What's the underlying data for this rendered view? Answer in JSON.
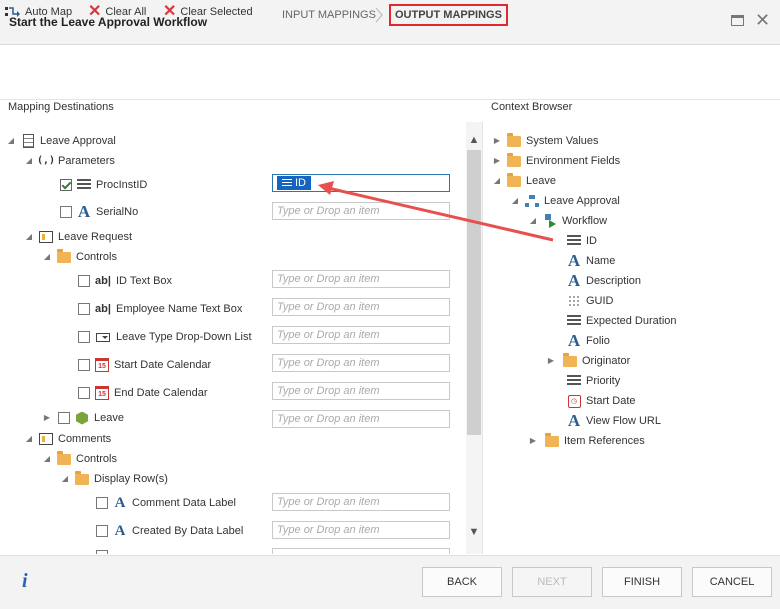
{
  "window": {
    "title": "Start the Leave Approval Workflow"
  },
  "steps": {
    "input": "INPUT MAPPINGS",
    "output": "OUTPUT MAPPINGS"
  },
  "toolbar": {
    "automap": "Auto Map",
    "clear_all": "Clear All",
    "clear_selected": "Clear Selected"
  },
  "left": {
    "header": "Mapping Destinations",
    "leave_approval": "Leave Approval",
    "parameters": "Parameters",
    "procinstid": "ProcInstID",
    "procinstid_value": "ID",
    "serialno": "SerialNo",
    "leave_request": "Leave Request",
    "controls": "Controls",
    "id_text_box": "ID Text Box",
    "employee_name": "Employee Name Text Box",
    "leave_type": "Leave Type Drop-Down List",
    "start_date_cal": "Start Date Calendar",
    "end_date_cal": "End Date Calendar",
    "leave": "Leave",
    "comments": "Comments",
    "controls2": "Controls",
    "display_rows": "Display Row(s)",
    "comment_label": "Comment Data Label",
    "created_by": "Created By Data Label",
    "placeholder": "Type or Drop an item"
  },
  "right": {
    "header": "Context Browser",
    "system_values": "System Values",
    "environment_fields": "Environment Fields",
    "leave": "Leave",
    "leave_approval": "Leave Approval",
    "workflow": "Workflow",
    "id": "ID",
    "name": "Name",
    "description": "Description",
    "guid": "GUID",
    "expected_duration": "Expected Duration",
    "folio": "Folio",
    "originator": "Originator",
    "priority": "Priority",
    "start_date": "Start Date",
    "view_flow_url": "View Flow URL",
    "item_references": "Item References"
  },
  "footer": {
    "back": "BACK",
    "next": "NEXT",
    "finish": "FINISH",
    "cancel": "CANCEL"
  },
  "colors": {
    "accent": "#1565c0",
    "highlight": "#e0292a",
    "arrow": "#e8504e"
  }
}
